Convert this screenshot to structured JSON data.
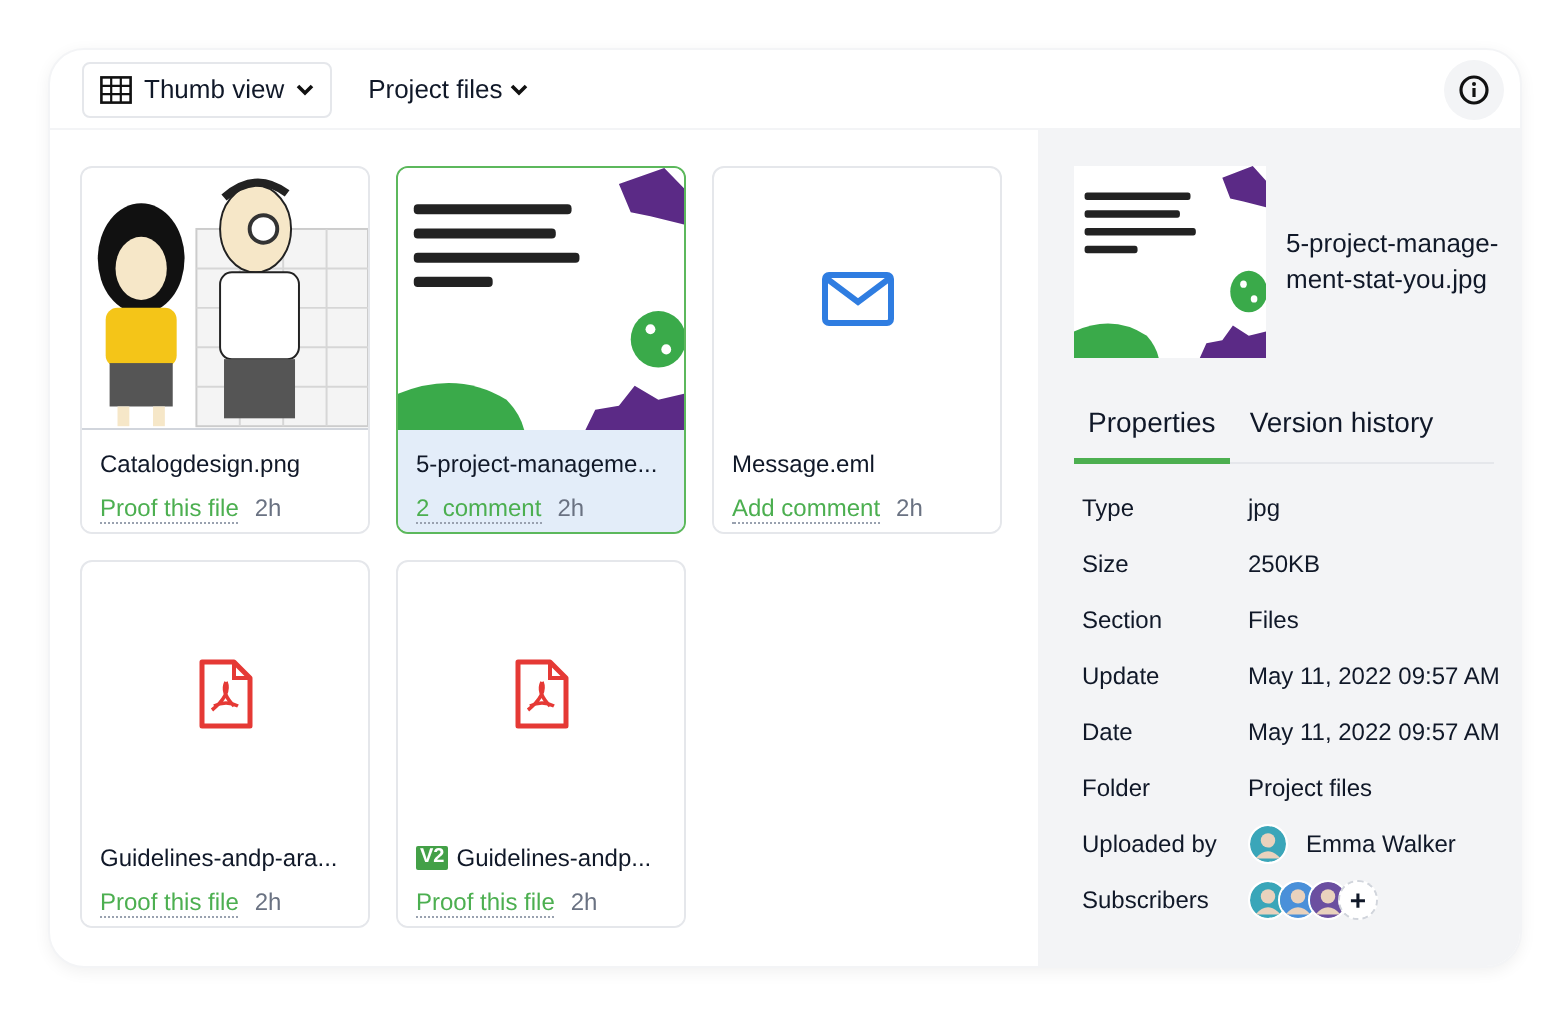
{
  "toolbar": {
    "view_button": "Thumb view",
    "folder_button": "Project files"
  },
  "files": [
    {
      "name": "Catalogdesign.png",
      "kind": "illustration",
      "action": "Proof this file",
      "time": "2h",
      "selected": false
    },
    {
      "name": "5-project-manageme...",
      "kind": "graphic",
      "action": "2  comment",
      "time": "2h",
      "selected": true
    },
    {
      "name": "Message.eml",
      "kind": "email",
      "action": "Add comment",
      "time": "2h",
      "selected": false
    },
    {
      "name": "Guidelines-andp-ara...",
      "kind": "pdf",
      "action": "Proof this file",
      "time": "2h",
      "selected": false
    },
    {
      "name": "Guidelines-andp...",
      "kind": "pdf",
      "badge": "V2",
      "action": "Proof this file",
      "time": "2h",
      "selected": false
    }
  ],
  "details": {
    "file_name_lines": [
      "5-project-manage-",
      "ment-stat-you.jpg"
    ],
    "tabs": [
      {
        "label": "Properties",
        "selected": true
      },
      {
        "label": "Version history",
        "selected": false
      }
    ],
    "properties": [
      {
        "label": "Type",
        "value": "jpg"
      },
      {
        "label": "Size",
        "value": "250KB"
      },
      {
        "label": "Section",
        "value": "Files"
      },
      {
        "label": "Update",
        "value": "May 11, 2022 09:57 AM"
      },
      {
        "label": "Date",
        "value": "May 11, 2022 09:57 AM"
      },
      {
        "label": "Folder",
        "value": "Project files"
      }
    ],
    "uploaded_by": {
      "label": "Uploaded by",
      "name": "Emma Walker"
    },
    "subscribers": {
      "label": "Subscribers",
      "members": [
        {
          "kind": "avatar"
        },
        {
          "kind": "avatar"
        },
        {
          "kind": "avatar"
        }
      ],
      "add": "+"
    }
  }
}
